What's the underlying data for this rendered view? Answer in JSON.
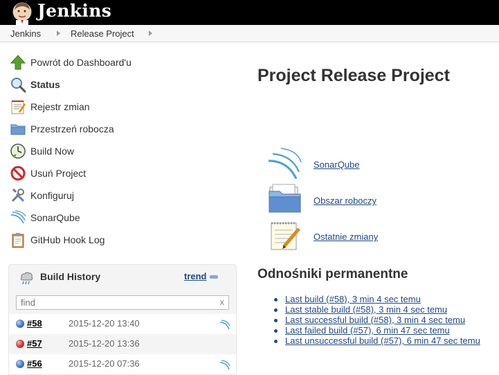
{
  "header": {
    "brand": "Jenkins"
  },
  "breadcrumb": {
    "items": [
      "Jenkins",
      "Release Project"
    ]
  },
  "sidebar": {
    "tasks": [
      {
        "label": "Powrót do Dashboard'u",
        "icon": "up-arrow-icon"
      },
      {
        "label": "Status",
        "icon": "magnifier-icon"
      },
      {
        "label": "Rejestr zmian",
        "icon": "notepad-icon"
      },
      {
        "label": "Przestrzeń robocza",
        "icon": "folder-icon"
      },
      {
        "label": "Build Now",
        "icon": "clock-icon"
      },
      {
        "label": "Usuń Project",
        "icon": "no-entry-icon"
      },
      {
        "label": "Konfiguruj",
        "icon": "tools-icon"
      },
      {
        "label": "SonarQube",
        "icon": "sonarqube-icon"
      },
      {
        "label": "GitHub Hook Log",
        "icon": "clipboard-icon"
      }
    ]
  },
  "build_history": {
    "title": "Build History",
    "trend": "trend",
    "search_placeholder": "find",
    "clear": "x",
    "builds": [
      {
        "number": "#58",
        "date": "2015-12-20 13:40",
        "status": "blue",
        "sonar": true
      },
      {
        "number": "#57",
        "date": "2015-12-20 13:36",
        "status": "red",
        "sonar": false
      },
      {
        "number": "#56",
        "date": "2015-12-20 07:36",
        "status": "blue",
        "sonar": true
      }
    ]
  },
  "main": {
    "title": "Project Release Project",
    "links": [
      {
        "label": "SonarQube",
        "icon": "sonarqube-icon"
      },
      {
        "label": "Obszar roboczy",
        "icon": "folder-icon"
      },
      {
        "label": "Ostatnie zmiany",
        "icon": "notepad-icon"
      }
    ],
    "permalinks_title": "Odnośniki permanentne",
    "permalinks": [
      "Last build (#58), 3 min 4 sec temu",
      "Last stable build (#58), 3 min 4 sec temu",
      "Last successful build (#58), 3 min 4 sec temu",
      "Last failed build (#57), 6 min 47 sec temu",
      "Last unsuccessful build (#57), 6 min 47 sec temu"
    ]
  },
  "colors": {
    "link": "#204a87",
    "header_bg": "#000000",
    "ball_blue": "#4a7cc7",
    "ball_red": "#d23a3a"
  }
}
